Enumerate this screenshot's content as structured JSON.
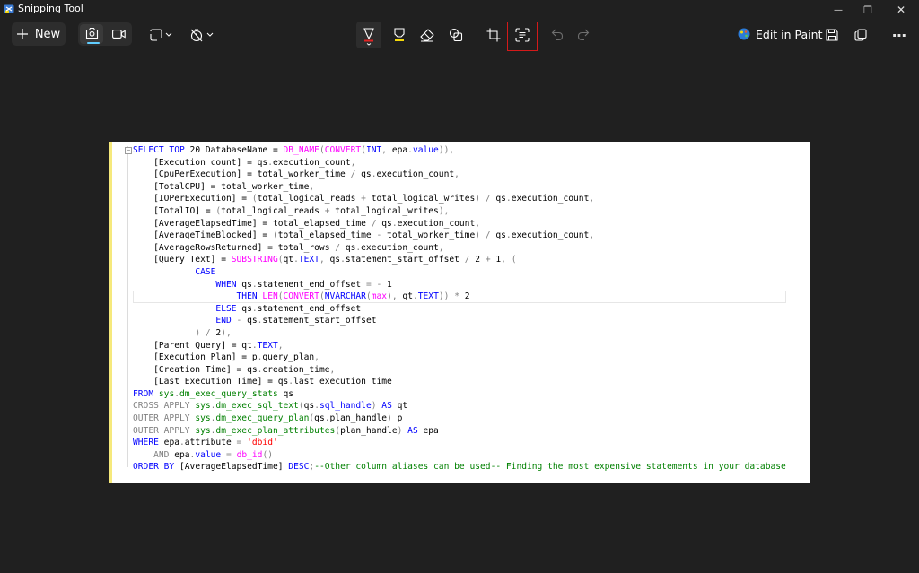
{
  "window": {
    "title": "Snipping Tool",
    "minimize_glyph": "—",
    "maximize_glyph": "❐",
    "close_glyph": "✕"
  },
  "toolbar": {
    "new_label": "New",
    "edit_in_paint_label": "Edit in Paint",
    "more_glyph": "⋯",
    "icons": [
      "camera-icon",
      "video-icon",
      "rectangle-mode-icon",
      "delay-timer-icon",
      "ballpoint-pen-icon",
      "highlighter-icon",
      "eraser-icon",
      "shapes-icon",
      "crop-icon",
      "text-actions-icon",
      "undo-icon",
      "redo-icon",
      "paint-icon",
      "save-icon",
      "copy-icon",
      "more-icon"
    ],
    "colors": {
      "accent": "#60cdff",
      "highlight_box": "#d41a1a",
      "pen_red": "#e22424",
      "highlighter_yellow": "#f5d90a"
    }
  },
  "code_lines": [
    [
      [
        "kw",
        "SELECT TOP "
      ],
      [
        "t",
        "20 DatabaseName = "
      ],
      [
        "fn",
        "DB_NAME"
      ],
      [
        "gr",
        "("
      ],
      [
        "fn",
        "CONVERT"
      ],
      [
        "gr",
        "("
      ],
      [
        "kw",
        "INT"
      ],
      [
        "gr",
        ", "
      ],
      [
        "t",
        "epa"
      ],
      [
        "gr",
        "."
      ],
      [
        "kw",
        "value"
      ],
      [
        "gr",
        "))"
      ],
      [
        "gr",
        ","
      ]
    ],
    [
      [
        "t",
        "    [Execution count] = qs"
      ],
      [
        "gr",
        "."
      ],
      [
        "t",
        "execution_count"
      ],
      [
        "gr",
        ","
      ]
    ],
    [
      [
        "t",
        "    [CpuPerExecution] = total_worker_time "
      ],
      [
        "gr",
        "/"
      ],
      [
        "t",
        " qs"
      ],
      [
        "gr",
        "."
      ],
      [
        "t",
        "execution_count"
      ],
      [
        "gr",
        ","
      ]
    ],
    [
      [
        "t",
        "    [TotalCPU] = total_worker_time"
      ],
      [
        "gr",
        ","
      ]
    ],
    [
      [
        "t",
        "    [IOPerExecution] = "
      ],
      [
        "gr",
        "("
      ],
      [
        "t",
        "total_logical_reads "
      ],
      [
        "gr",
        "+"
      ],
      [
        "t",
        " total_logical_writes"
      ],
      [
        "gr",
        ")"
      ],
      [
        "t",
        " "
      ],
      [
        "gr",
        "/"
      ],
      [
        "t",
        " qs"
      ],
      [
        "gr",
        "."
      ],
      [
        "t",
        "execution_count"
      ],
      [
        "gr",
        ","
      ]
    ],
    [
      [
        "t",
        "    [TotalIO] = "
      ],
      [
        "gr",
        "("
      ],
      [
        "t",
        "total_logical_reads "
      ],
      [
        "gr",
        "+"
      ],
      [
        "t",
        " total_logical_writes"
      ],
      [
        "gr",
        ")"
      ],
      [
        "gr",
        ","
      ]
    ],
    [
      [
        "t",
        "    [AverageElapsedTime] = total_elapsed_time "
      ],
      [
        "gr",
        "/"
      ],
      [
        "t",
        " qs"
      ],
      [
        "gr",
        "."
      ],
      [
        "t",
        "execution_count"
      ],
      [
        "gr",
        ","
      ]
    ],
    [
      [
        "t",
        "    [AverageTimeBlocked] = "
      ],
      [
        "gr",
        "("
      ],
      [
        "t",
        "total_elapsed_time "
      ],
      [
        "gr",
        "-"
      ],
      [
        "t",
        " total_worker_time"
      ],
      [
        "gr",
        ")"
      ],
      [
        "t",
        " "
      ],
      [
        "gr",
        "/"
      ],
      [
        "t",
        " qs"
      ],
      [
        "gr",
        "."
      ],
      [
        "t",
        "execution_count"
      ],
      [
        "gr",
        ","
      ]
    ],
    [
      [
        "t",
        "    [AverageRowsReturned] = total_rows "
      ],
      [
        "gr",
        "/"
      ],
      [
        "t",
        " qs"
      ],
      [
        "gr",
        "."
      ],
      [
        "t",
        "execution_count"
      ],
      [
        "gr",
        ","
      ]
    ],
    [
      [
        "t",
        "    [Query Text] = "
      ],
      [
        "fn",
        "SUBSTRING"
      ],
      [
        "gr",
        "("
      ],
      [
        "t",
        "qt"
      ],
      [
        "gr",
        "."
      ],
      [
        "kw",
        "TEXT"
      ],
      [
        "gr",
        ","
      ],
      [
        "t",
        " qs"
      ],
      [
        "gr",
        "."
      ],
      [
        "t",
        "statement_start_offset "
      ],
      [
        "gr",
        "/"
      ],
      [
        "t",
        " 2 "
      ],
      [
        "gr",
        "+"
      ],
      [
        "t",
        " 1"
      ],
      [
        "gr",
        ","
      ],
      [
        "t",
        " "
      ],
      [
        "gr",
        "("
      ]
    ],
    [
      [
        "t",
        "            "
      ],
      [
        "kw",
        "CASE"
      ]
    ],
    [
      [
        "t",
        "                "
      ],
      [
        "kw",
        "WHEN"
      ],
      [
        "t",
        " qs"
      ],
      [
        "gr",
        "."
      ],
      [
        "t",
        "statement_end_offset "
      ],
      [
        "gr",
        "="
      ],
      [
        "t",
        " "
      ],
      [
        "gr",
        "-"
      ],
      [
        "t",
        " 1"
      ]
    ],
    [
      [
        "t",
        "                    "
      ],
      [
        "kw",
        "THEN"
      ],
      [
        "t",
        " "
      ],
      [
        "fn",
        "LEN"
      ],
      [
        "gr",
        "("
      ],
      [
        "fn",
        "CONVERT"
      ],
      [
        "gr",
        "("
      ],
      [
        "kw",
        "NVARCHAR"
      ],
      [
        "gr",
        "("
      ],
      [
        "fn",
        "max"
      ],
      [
        "gr",
        "),"
      ],
      [
        "t",
        " qt"
      ],
      [
        "gr",
        "."
      ],
      [
        "kw",
        "TEXT"
      ],
      [
        "gr",
        "))"
      ],
      [
        "t",
        " "
      ],
      [
        "gr",
        "*"
      ],
      [
        "t",
        " 2"
      ]
    ],
    [
      [
        "t",
        "                "
      ],
      [
        "kw",
        "ELSE"
      ],
      [
        "t",
        " qs"
      ],
      [
        "gr",
        "."
      ],
      [
        "t",
        "statement_end_offset"
      ]
    ],
    [
      [
        "t",
        "                "
      ],
      [
        "kw",
        "END"
      ],
      [
        "t",
        " "
      ],
      [
        "gr",
        "-"
      ],
      [
        "t",
        " qs"
      ],
      [
        "gr",
        "."
      ],
      [
        "t",
        "statement_start_offset"
      ]
    ],
    [
      [
        "t",
        "            "
      ],
      [
        "gr",
        ")"
      ],
      [
        "t",
        " "
      ],
      [
        "gr",
        "/"
      ],
      [
        "t",
        " 2"
      ],
      [
        "gr",
        "),"
      ]
    ],
    [
      [
        "t",
        "    [Parent Query] = qt"
      ],
      [
        "gr",
        "."
      ],
      [
        "kw",
        "TEXT"
      ],
      [
        "gr",
        ","
      ]
    ],
    [
      [
        "t",
        "    [Execution Plan] = p"
      ],
      [
        "gr",
        "."
      ],
      [
        "t",
        "query_plan"
      ],
      [
        "gr",
        ","
      ]
    ],
    [
      [
        "t",
        "    [Creation Time] = qs"
      ],
      [
        "gr",
        "."
      ],
      [
        "t",
        "creation_time"
      ],
      [
        "gr",
        ","
      ]
    ],
    [
      [
        "t",
        "    [Last Execution Time] = qs"
      ],
      [
        "gr",
        "."
      ],
      [
        "t",
        "last_execution_time"
      ]
    ],
    [
      [
        "kw",
        "FROM "
      ],
      [
        "sys",
        "sys"
      ],
      [
        "gr",
        "."
      ],
      [
        "sys",
        "dm_exec_query_stats"
      ],
      [
        "t",
        " qs"
      ]
    ],
    [
      [
        "gr",
        "CROSS APPLY "
      ],
      [
        "sys",
        "sys"
      ],
      [
        "gr",
        "."
      ],
      [
        "sys",
        "dm_exec_sql_text"
      ],
      [
        "gr",
        "("
      ],
      [
        "t",
        "qs"
      ],
      [
        "gr",
        "."
      ],
      [
        "kw",
        "sql_handle"
      ],
      [
        "gr",
        ")"
      ],
      [
        "t",
        " "
      ],
      [
        "kw",
        "AS"
      ],
      [
        "t",
        " qt"
      ]
    ],
    [
      [
        "gr",
        "OUTER APPLY "
      ],
      [
        "sys",
        "sys"
      ],
      [
        "gr",
        "."
      ],
      [
        "sys",
        "dm_exec_query_plan"
      ],
      [
        "gr",
        "("
      ],
      [
        "t",
        "qs"
      ],
      [
        "gr",
        "."
      ],
      [
        "t",
        "plan_handle"
      ],
      [
        "gr",
        ")"
      ],
      [
        "t",
        " p"
      ]
    ],
    [
      [
        "gr",
        "OUTER APPLY "
      ],
      [
        "sys",
        "sys"
      ],
      [
        "gr",
        "."
      ],
      [
        "sys",
        "dm_exec_plan_attributes"
      ],
      [
        "gr",
        "("
      ],
      [
        "t",
        "plan_handle"
      ],
      [
        "gr",
        ")"
      ],
      [
        "t",
        " "
      ],
      [
        "kw",
        "AS"
      ],
      [
        "t",
        " epa"
      ]
    ],
    [
      [
        "kw",
        "WHERE"
      ],
      [
        "t",
        " epa"
      ],
      [
        "gr",
        "."
      ],
      [
        "t",
        "attribute "
      ],
      [
        "gr",
        "="
      ],
      [
        "t",
        " "
      ],
      [
        "str",
        "'dbid'"
      ]
    ],
    [
      [
        "t",
        "    "
      ],
      [
        "gr",
        "AND"
      ],
      [
        "t",
        " epa"
      ],
      [
        "gr",
        "."
      ],
      [
        "kw",
        "value"
      ],
      [
        "t",
        " "
      ],
      [
        "gr",
        "="
      ],
      [
        "t",
        " "
      ],
      [
        "fn",
        "db_id"
      ],
      [
        "gr",
        "()"
      ]
    ],
    [
      [
        "kw",
        "ORDER BY"
      ],
      [
        "t",
        " [AverageElapsedTime] "
      ],
      [
        "kw",
        "DESC"
      ],
      [
        "gr",
        ";"
      ],
      [
        "cm",
        "--Other column aliases can be used-- Finding the most expensive statements in your database"
      ]
    ]
  ]
}
